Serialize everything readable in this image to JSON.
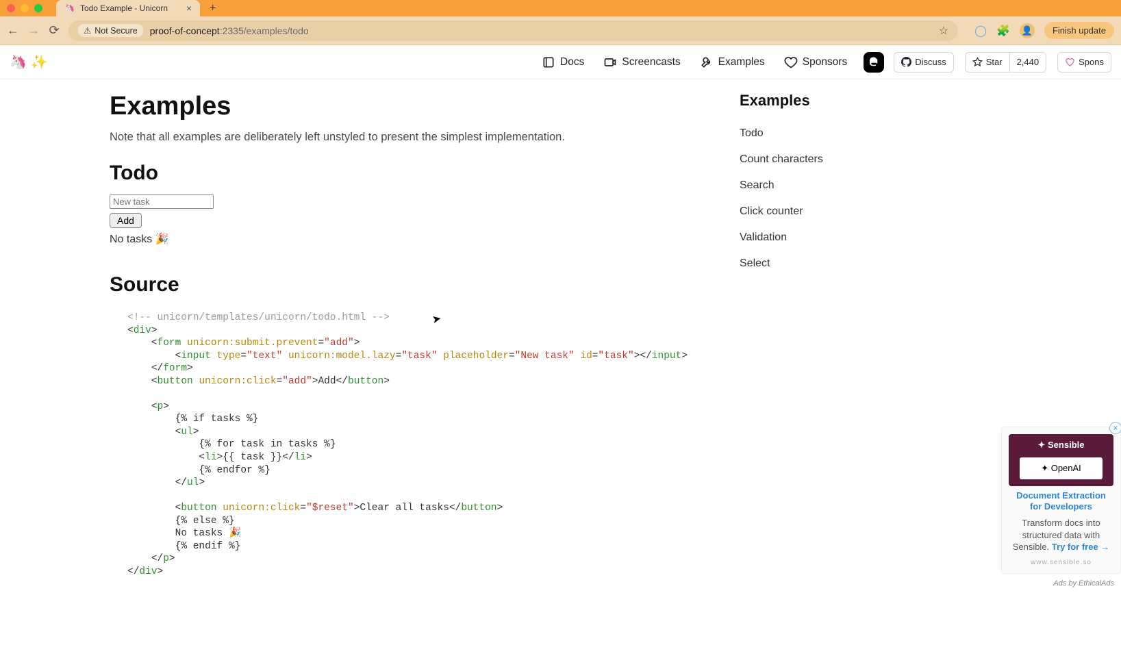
{
  "browser": {
    "tab_title": "Todo Example - Unicorn",
    "not_secure_label": "Not Secure",
    "url_host": "proof-of-concept",
    "url_port_path": ":2335/examples/todo",
    "finish_update": "Finish update"
  },
  "nav": {
    "docs": "Docs",
    "screencasts": "Screencasts",
    "examples": "Examples",
    "sponsors": "Sponsors",
    "discuss": "Discuss",
    "star": "Star",
    "star_count": "2,440",
    "spons": "Spons"
  },
  "page": {
    "title": "Examples",
    "subtitle": "Note that all examples are deliberately left unstyled to present the simplest implementation.",
    "todo_heading": "Todo",
    "input_placeholder": "New task",
    "add_label": "Add",
    "no_tasks": "No tasks 🎉",
    "source_heading": "Source"
  },
  "sidebar": {
    "heading": "Examples",
    "items": [
      "Todo",
      "Count characters",
      "Search",
      "Click counter",
      "Validation",
      "Select"
    ]
  },
  "code": {
    "comment": "<!-- unicorn/templates/unicorn/todo.html -->",
    "t_div": "div",
    "t_form": "form",
    "t_input": "input",
    "t_button": "button",
    "t_p": "p",
    "t_ul": "ul",
    "t_li": "li",
    "a_submit": "unicorn:submit.prevent",
    "v_add": "\"add\"",
    "a_type": "type",
    "v_text": "\"text\"",
    "a_model": "unicorn:model.lazy",
    "v_task": "\"task\"",
    "a_placeholder": "placeholder",
    "v_newtask": "\"New task\"",
    "a_id": "id",
    "v_taskid": "\"task\"",
    "a_click": "unicorn:click",
    "v_reset": "\"$reset\"",
    "txt_add": "Add",
    "tmpl_if": "{% if tasks %}",
    "tmpl_for": "{% for task in tasks %}",
    "tmpl_task": "{{ task }}",
    "tmpl_endfor": "{% endfor %}",
    "txt_clear": "Clear all tasks",
    "tmpl_else": "{% else %}",
    "txt_notasks": "No tasks 🎉",
    "tmpl_endif": "{% endif %}"
  },
  "ad": {
    "brand": "✦ Sensible",
    "openai": "✦ OpenAI",
    "title": "Document Extraction for Developers",
    "body1": "Transform docs into structured data with Sensible. ",
    "cta": "Try for free →",
    "url": "www.sensible.so",
    "footer": "Ads by EthicalAds"
  }
}
